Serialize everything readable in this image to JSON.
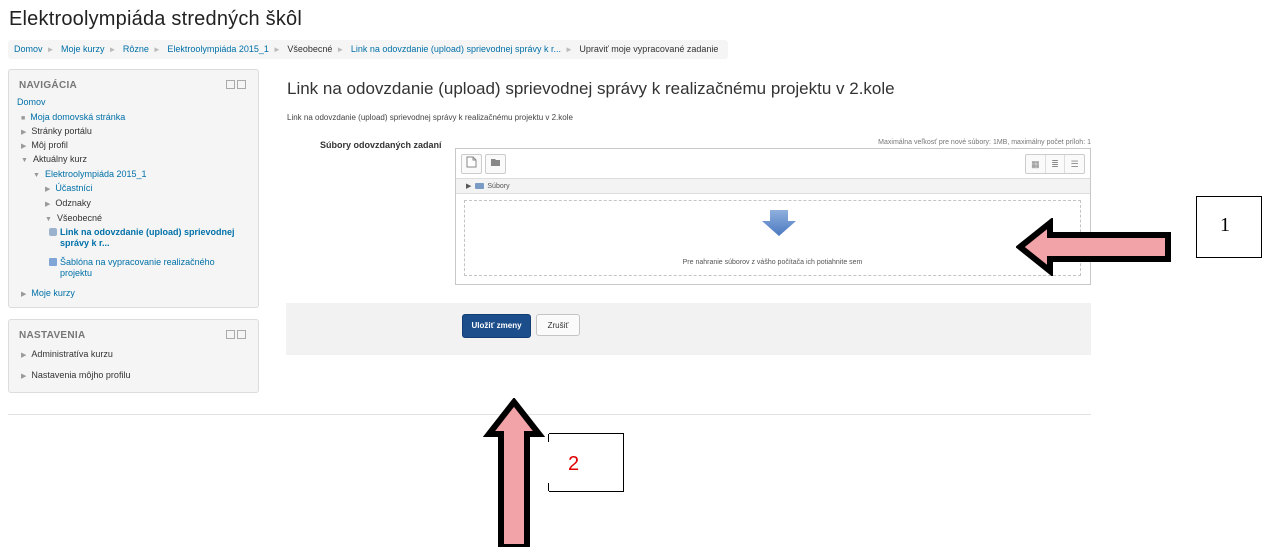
{
  "site": {
    "title": "Elektroolympiáda stredných škôl"
  },
  "breadcrumb": [
    {
      "label": "Domov",
      "link": true
    },
    {
      "label": "Moje kurzy",
      "link": true
    },
    {
      "label": "Rôzne",
      "link": true
    },
    {
      "label": "Elektroolympiáda 2015_1",
      "link": true
    },
    {
      "label": "Všeobecné",
      "link": false
    },
    {
      "label": "Link na odovzdanie (upload) sprievodnej správy k r...",
      "link": true
    },
    {
      "label": "Upraviť moje vypracované zadanie",
      "link": false
    }
  ],
  "navigation": {
    "title": "NAVIGÁCIA",
    "home": "Domov",
    "dashboard": "Moja domovská stránka",
    "site_pages": "Stránky portálu",
    "my_profile": "Môj profil",
    "current_course": "Aktuálny kurz",
    "course": "Elektroolympiáda 2015_1",
    "participants": "Účastníci",
    "badges": "Odznaky",
    "general": "Všeobecné",
    "active_item_line1": "Link na odovzdanie (upload) sprievodnej",
    "active_item_line2": "správy k r...",
    "template_line1": "Šablóna na vypracovanie realizačného",
    "template_line2": "projektu",
    "my_courses": "Moje kurzy"
  },
  "settings": {
    "title": "NASTAVENIA",
    "course_admin": "Administratíva kurzu",
    "profile_settings": "Nastavenia môjho profilu"
  },
  "main": {
    "heading": "Link na odovzdanie (upload) sprievodnej správy k realizačnému projektu v 2.kole",
    "intro": "Link na odovzdanie (upload) sprievodnej správy k realizačnému projektu v 2.kole",
    "files_label": "Súbory odovzdaných zadaní",
    "limits": "Maximálna veľkosť pre nové súbory: 1MB, maximálny počet príloh: 1",
    "path_label": "Súbory",
    "drop_text": "Pre nahranie súborov z vášho počítača ich potiahnite sem",
    "save_label": "Uložiť zmeny",
    "cancel_label": "Zrušiť"
  },
  "annotations": {
    "box1": "1",
    "box2": "2"
  },
  "colors": {
    "link": "#0070a8",
    "primary_button": "#1b4e8a",
    "arrow_fill": "#f2a3a8",
    "annotation_red": "#e00000"
  },
  "icons": [
    "add-file-icon",
    "create-folder-icon",
    "view-icons-icon",
    "view-list-icon",
    "view-tree-icon",
    "folder-icon",
    "download-arrow-icon",
    "pointer-arrow-icon"
  ]
}
